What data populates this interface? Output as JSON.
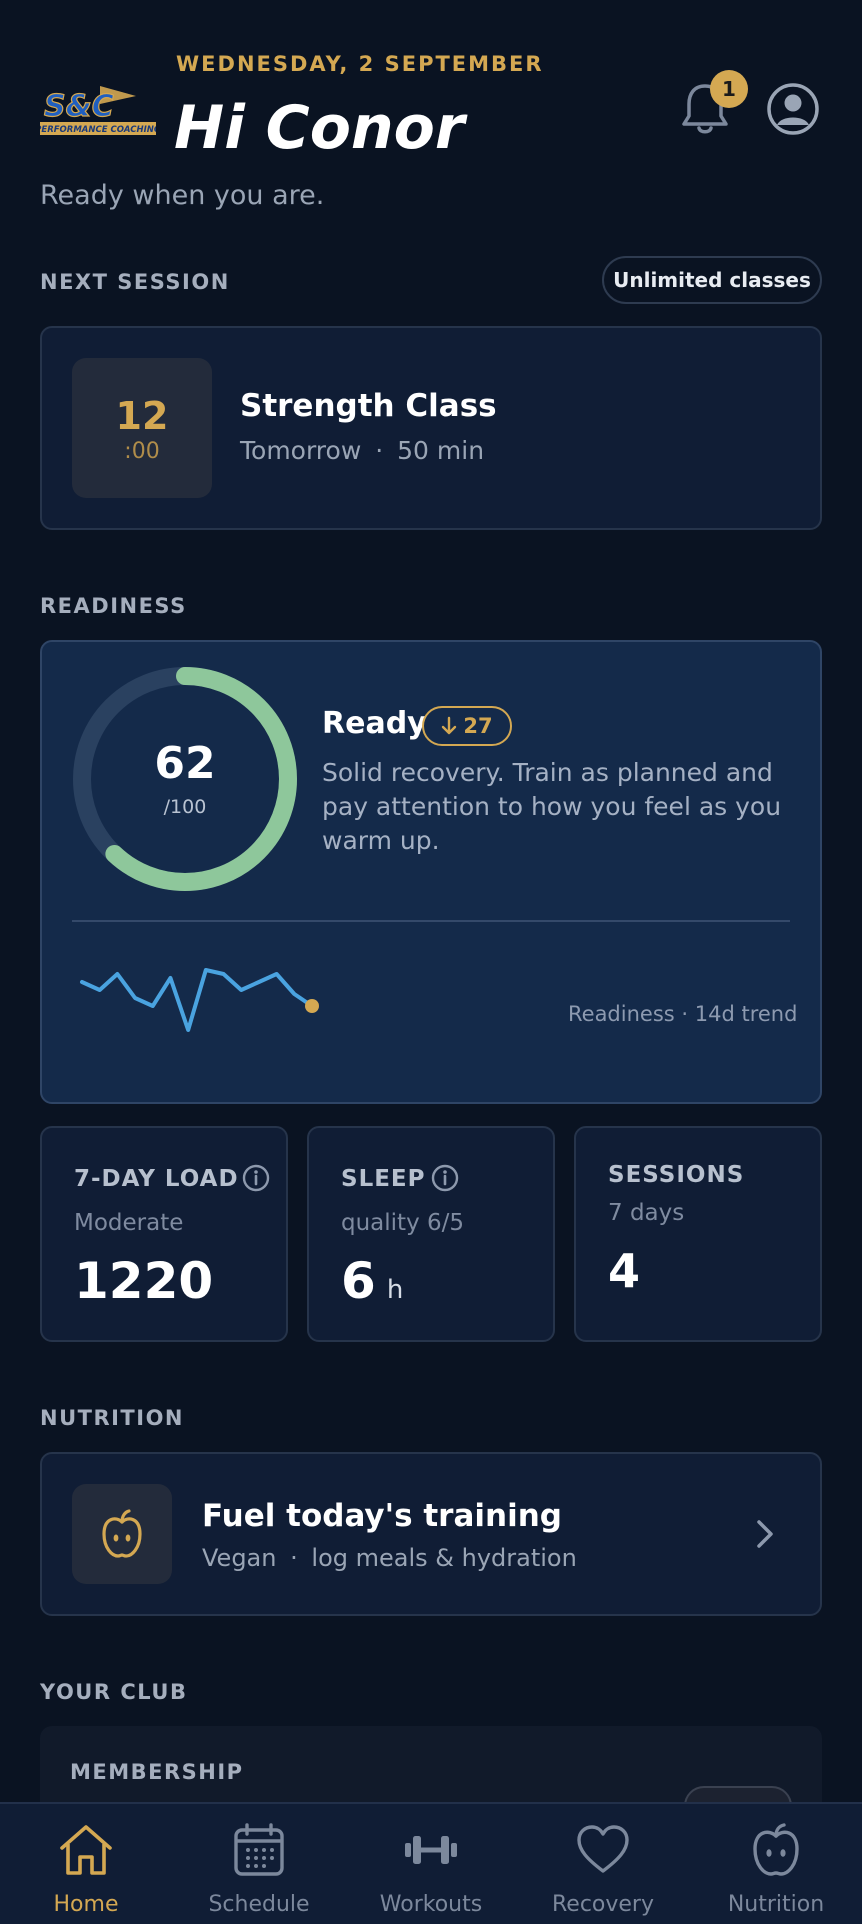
{
  "header": {
    "date": "WEDNESDAY, 2 SEPTEMBER",
    "greeting": "Hi Conor",
    "subtitle": "Ready when you are.",
    "notification_count": "1",
    "logo_text": "S&C",
    "logo_subtext": "PERFORMANCE COACHING"
  },
  "next_session": {
    "section_label": "NEXT SESSION",
    "membership_pill": "Unlimited classes",
    "hour": "12",
    "minutes": ":00",
    "title": "Strength Class",
    "day": "Tomorrow",
    "separator": "·",
    "duration": "50 min"
  },
  "readiness": {
    "section_label": "READINESS",
    "score": "62",
    "max": "/100",
    "score_value": 62,
    "status": "Ready",
    "delta": "27",
    "delta_direction": "down",
    "description": "Solid recovery. Train as planned and pay attention to how you feel as you warm up.",
    "trend_label": "Readiness · 14d trend",
    "trend_values": [
      60,
      58,
      62,
      56,
      54,
      61,
      48,
      63,
      62,
      58,
      60,
      62,
      57,
      54
    ]
  },
  "stats": {
    "load": {
      "title": "7-DAY LOAD",
      "sub": "Moderate",
      "value": "1220"
    },
    "sleep": {
      "title": "SLEEP",
      "sub": "quality 6/5",
      "value": "6",
      "unit": "h"
    },
    "sessions": {
      "title": "SESSIONS",
      "sub": "7 days",
      "value": "4"
    }
  },
  "nutrition": {
    "section_label": "NUTRITION",
    "title": "Fuel today's training",
    "diet": "Vegan",
    "separator": "·",
    "action": "log meals & hydration"
  },
  "club": {
    "section_label": "YOUR CLUB",
    "membership_label": "MEMBERSHIP"
  },
  "nav": {
    "items": [
      {
        "label": "Home",
        "icon": "home-icon",
        "active": true
      },
      {
        "label": "Schedule",
        "icon": "calendar-icon",
        "active": false
      },
      {
        "label": "Workouts",
        "icon": "dumbbell-icon",
        "active": false
      },
      {
        "label": "Recovery",
        "icon": "heart-icon",
        "active": false
      },
      {
        "label": "Nutrition",
        "icon": "apple-icon",
        "active": false
      }
    ]
  },
  "colors": {
    "background": "#0a1322",
    "card": "#101d35",
    "accent_gold": "#d4a852",
    "ring_green": "#8ec79b",
    "trend_blue": "#4aa3e0"
  }
}
